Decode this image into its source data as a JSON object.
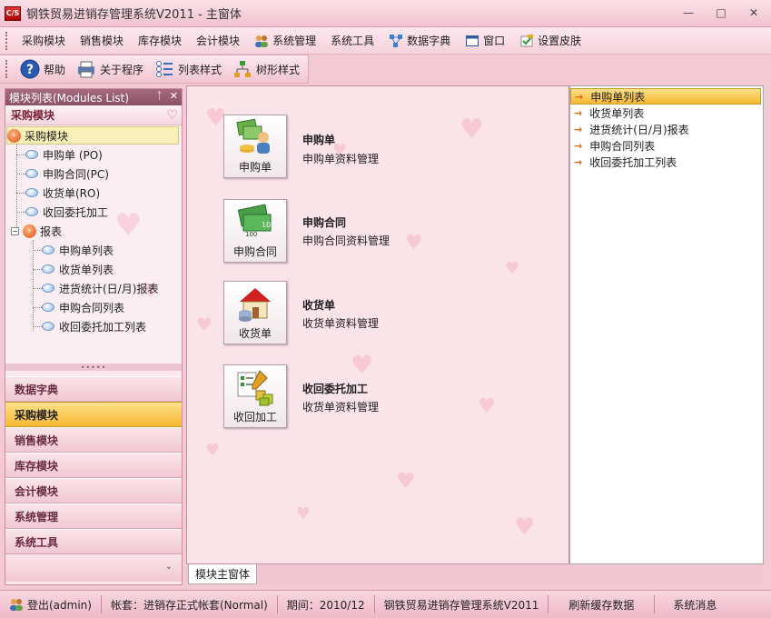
{
  "window": {
    "app_icon_text": "C/S",
    "title": "钢铁贸易进销存管理系统V2011 - 主窗体",
    "minimize": "—",
    "maximize": "□",
    "close": "✕"
  },
  "menu": {
    "items": [
      {
        "label": "采购模块"
      },
      {
        "label": "销售模块"
      },
      {
        "label": "库存模块"
      },
      {
        "label": "会计模块"
      },
      {
        "label": "系统管理",
        "icon": "users-icon"
      },
      {
        "label": "系统工具"
      },
      {
        "label": "数据字典",
        "icon": "dictionary-icon"
      },
      {
        "label": "窗口",
        "icon": "window-icon"
      },
      {
        "label": "设置皮肤",
        "icon": "skin-icon"
      }
    ]
  },
  "toolbar": {
    "help": "帮助",
    "about": "关于程序",
    "list_style": "列表样式",
    "tree_style": "树形样式"
  },
  "left_panel": {
    "header": "模块列表(Modules List)",
    "pin": "ᛏ",
    "close": "✕",
    "group_title": "采购模块",
    "tree": {
      "root": "采购模块",
      "items": [
        "申购单 (PO)",
        "申购合同(PC)",
        "收货单(RO)",
        "收回委托加工"
      ],
      "reports": "报表",
      "report_items": [
        "申购单列表",
        "收货单列表",
        "进货统计(日/月)报表",
        "申购合同列表",
        "收回委托加工列表"
      ]
    },
    "grip": "•••••",
    "modules": [
      "数据字典",
      "采购模块",
      "销售模块",
      "库存模块",
      "会计模块",
      "系统管理",
      "系统工具"
    ],
    "active_module": "采购模块",
    "footer_chevron": "⌄"
  },
  "main": {
    "cards": [
      {
        "label": "申购单",
        "title": "申购单",
        "desc": "申购单资料管理"
      },
      {
        "label": "申购合同",
        "title": "申购合同",
        "desc": "申购合同资料管理"
      },
      {
        "label": "收货单",
        "title": "收货单",
        "desc": "收货单资料管理"
      },
      {
        "label": "收回加工",
        "title": "收回委托加工",
        "desc": "收货单资料管理"
      }
    ]
  },
  "right_panel": {
    "items": [
      "申购单列表",
      "收货单列表",
      "进货统计(日/月)报表",
      "申购合同列表",
      "收回委托加工列表"
    ]
  },
  "tab": {
    "label": "模块主窗体"
  },
  "status": {
    "login": "登出(admin)",
    "account": "帐套：进销存正式帐套(Normal)",
    "period": "期间：2010/12",
    "system": "钢铁贸易进销存管理系统V2011",
    "refresh": "刷新缓存数据",
    "messages": "系统消息"
  },
  "colors": {
    "accent": "#f6b830",
    "panel_header": "#8c5166",
    "background": "#fbe3ea"
  }
}
